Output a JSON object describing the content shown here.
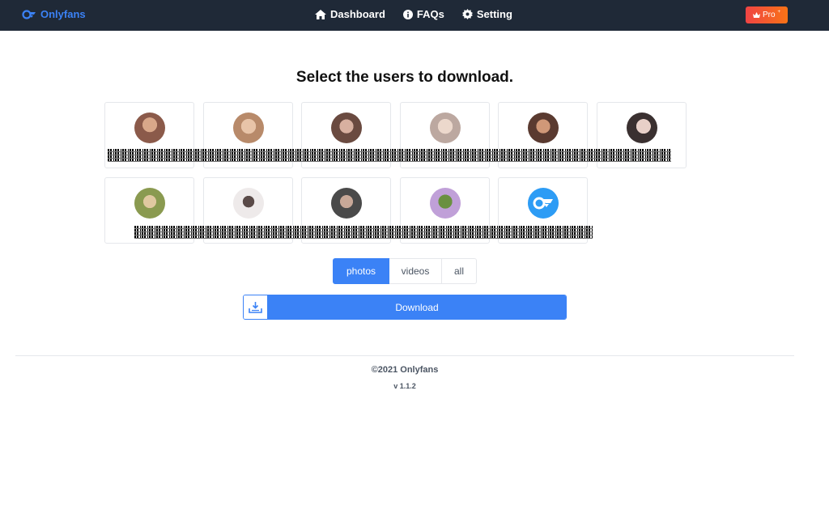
{
  "nav": {
    "brand": "Onlyfans",
    "links": [
      {
        "label": "Dashboard",
        "icon": "home-icon"
      },
      {
        "label": "FAQs",
        "icon": "info-icon"
      },
      {
        "label": "Setting",
        "icon": "gear-icon"
      }
    ],
    "pro_label": "Pro",
    "pro_badge": "+"
  },
  "heading": "Select the users to download.",
  "users_row1": [
    {
      "avatar_color": "#8b5a4a"
    },
    {
      "avatar_color": "#b88a6a"
    },
    {
      "avatar_color": "#a0786a"
    },
    {
      "avatar_color": "#d4b8a8"
    },
    {
      "avatar_color": "#9a6a50"
    },
    {
      "avatar_color": "#c0a8a0"
    }
  ],
  "users_row2": [
    {
      "avatar_color": "#c8b070"
    },
    {
      "avatar_color": "#e0dada"
    },
    {
      "avatar_color": "#8a7a78"
    },
    {
      "avatar_color": "#6a7a50"
    },
    {
      "avatar_color": "#2d9cf5",
      "is_logo": true
    }
  ],
  "media_tabs": [
    {
      "label": "photos",
      "active": true
    },
    {
      "label": "videos",
      "active": false
    },
    {
      "label": "all",
      "active": false
    }
  ],
  "download_label": "Download",
  "footer": {
    "copyright": "©2021 Onlyfans",
    "version": "v 1.1.2"
  },
  "colors": {
    "nav_bg": "#1f2937",
    "accent": "#3b82f6",
    "pro_gradient_start": "#ef4444",
    "pro_gradient_end": "#f97316"
  }
}
